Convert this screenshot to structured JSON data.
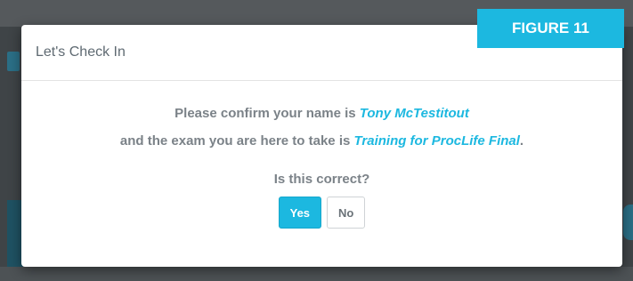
{
  "figure_label": "FIGURE 11",
  "modal": {
    "title": "Let's Check In",
    "line1_prefix": "Please confirm your name is ",
    "name": "Tony McTestitout",
    "line2_prefix": "and the exam you are here to take is ",
    "exam": "Training for ProcLife Final",
    "line2_suffix": ".",
    "question": "Is this correct?",
    "yes_label": "Yes",
    "no_label": "No"
  },
  "colors": {
    "accent": "#1cb8e0",
    "text": "#7b8288",
    "overlay": "#3f4447"
  }
}
